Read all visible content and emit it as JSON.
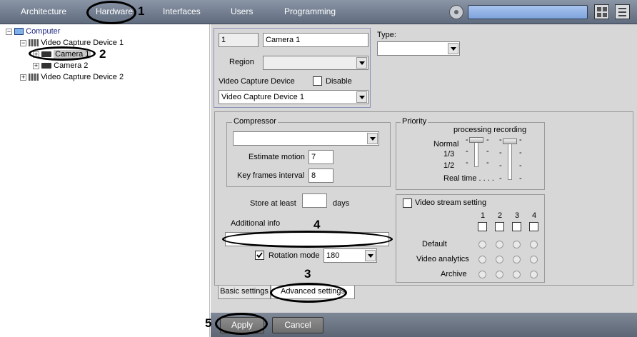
{
  "toolbar": {
    "tabs": [
      "Architecture",
      "Hardware",
      "Interfaces",
      "Users",
      "Programming"
    ]
  },
  "annotations": [
    "1",
    "2",
    "3",
    "4",
    "5"
  ],
  "tree": {
    "root": "Computer",
    "device1": "Video Capture Device 1",
    "camera1": "Camera 1",
    "camera2": "Camera 2",
    "device2": "Video Capture Device 2"
  },
  "basic": {
    "id": "1",
    "name": "Camera 1",
    "region_label": "Region",
    "region_value": "",
    "vcd_label": "Video Capture Device",
    "disable_label": "Disable",
    "vcd_value": "Video Capture Device 1",
    "type_label": "Type:",
    "type_value": ""
  },
  "compressor": {
    "title": "Compressor",
    "value": "",
    "estimate_label": "Estimate motion",
    "estimate_value": "7",
    "keyframes_label": "Key frames interval",
    "keyframes_value": "8"
  },
  "priority": {
    "title": "Priority",
    "header": "processing recording",
    "levels": [
      "Normal",
      "1/3",
      "1/2",
      "Real time . . . ."
    ]
  },
  "store": {
    "label": "Store at least",
    "value": "",
    "unit": "days"
  },
  "additional": {
    "label": "Additional info",
    "value": ""
  },
  "rotation": {
    "label": "Rotation mode",
    "value": "180",
    "checked": true
  },
  "video_stream": {
    "label": "Video stream setting",
    "columns": [
      "1",
      "2",
      "3",
      "4"
    ],
    "rows": [
      "Default",
      "Video analytics",
      "Archive"
    ]
  },
  "subtabs": [
    "Basic settings",
    "Advanced settings"
  ],
  "buttons": {
    "apply": "Apply",
    "cancel": "Cancel"
  }
}
